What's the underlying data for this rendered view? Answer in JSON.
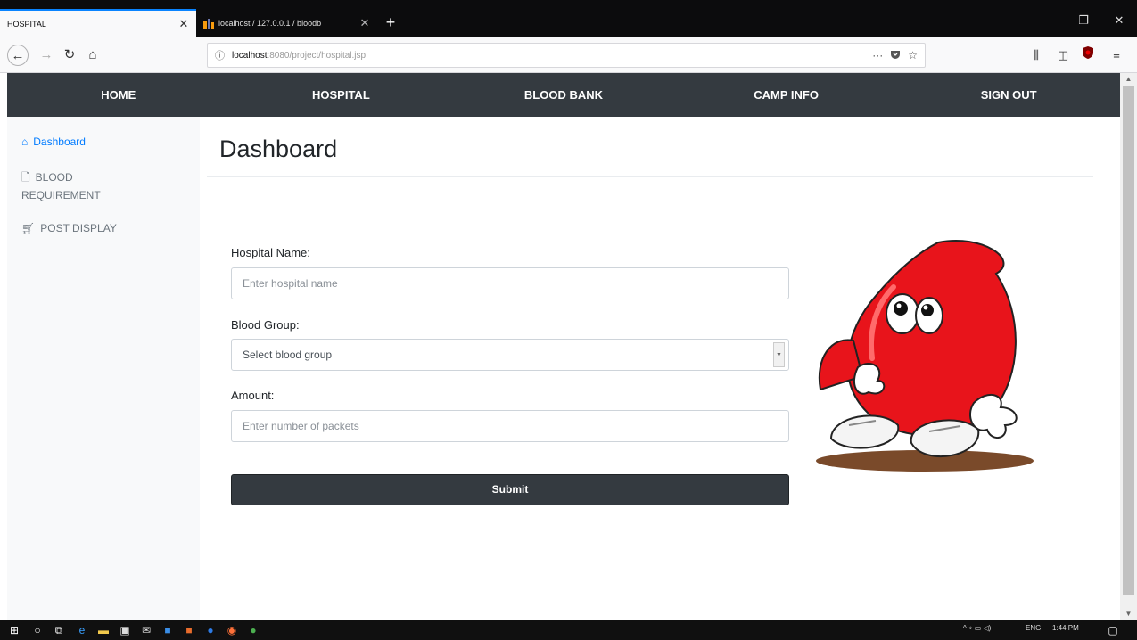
{
  "browser": {
    "tab_inactive": {
      "title": "HOSPITAL",
      "close": "✕"
    },
    "tab_active": {
      "title": "localhost / 127.0.0.1 / bloodb",
      "close": "✕"
    },
    "new_tab": "+",
    "window_controls": {
      "minimize": "–",
      "restore": "❐",
      "close": "✕"
    },
    "url": {
      "host": "localhost",
      "path": ":8080/project/hospital.jsp",
      "more": "···"
    }
  },
  "site_nav": {
    "items": [
      "HOME",
      "HOSPITAL",
      "BLOOD BANK",
      "CAMP INFO",
      "SIGN OUT"
    ]
  },
  "sidebar": {
    "items": [
      {
        "label": "Dashboard",
        "icon": "home-icon"
      },
      {
        "label": "BLOOD REQUIREMENT",
        "icon": "file-icon"
      },
      {
        "label": "POST DISPLAY",
        "icon": "cart-icon"
      }
    ]
  },
  "main": {
    "title": "Dashboard",
    "hospital_label": "Hospital Name:",
    "hospital_placeholder": "Enter hospital name",
    "blood_label": "Blood Group:",
    "blood_selected": "Select blood group",
    "amount_label": "Amount:",
    "amount_placeholder": "Enter number of packets",
    "submit": "Submit"
  },
  "taskbar": {
    "lang": "ENG",
    "time": "1:44 PM"
  },
  "colors": {
    "nav_dark": "#343a40",
    "link_active": "#007bff",
    "mascot_red": "#e8141b"
  }
}
